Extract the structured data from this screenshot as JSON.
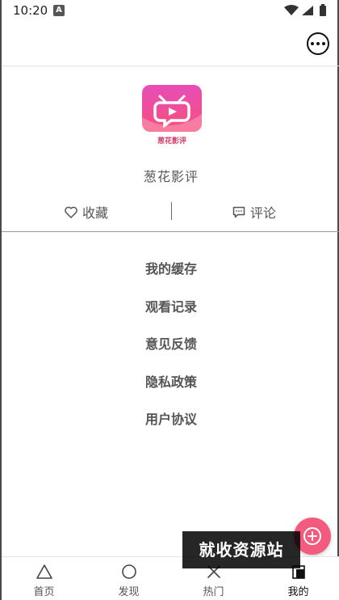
{
  "status_bar": {
    "time": "10:20",
    "notif_letter": "A"
  },
  "app": {
    "name": "葱花影评",
    "logo_caption": "葱花影评"
  },
  "actions": {
    "favorite_label": "收藏",
    "comment_label": "评论"
  },
  "menu": {
    "items": [
      {
        "label": "我的缓存"
      },
      {
        "label": "观看记录"
      },
      {
        "label": "意见反馈"
      },
      {
        "label": "隐私政策"
      },
      {
        "label": "用户协议"
      }
    ]
  },
  "watermark": {
    "text": "就收资源站"
  },
  "tabbar": {
    "tabs": [
      {
        "label": "首页",
        "icon": "triangle-icon"
      },
      {
        "label": "发现",
        "icon": "circle-icon"
      },
      {
        "label": "热门",
        "icon": "cross-icon"
      },
      {
        "label": "我的",
        "icon": "square-icon",
        "active": true
      }
    ]
  },
  "colors": {
    "accent": "#f25b7e",
    "logo_top": "#e84db8",
    "logo_bottom": "#f5507a"
  }
}
